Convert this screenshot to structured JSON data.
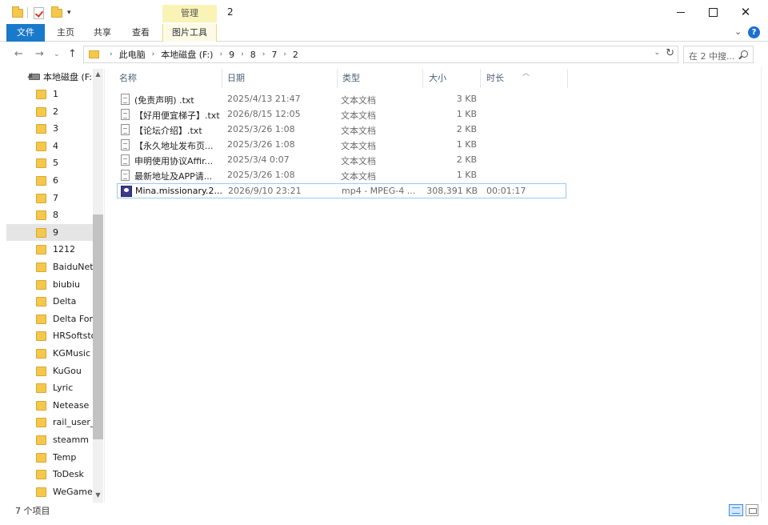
{
  "window": {
    "title": "2",
    "context_tab_header": "管理"
  },
  "ribbon": {
    "tabs": [
      "文件",
      "主页",
      "共享",
      "查看",
      "图片工具"
    ]
  },
  "address": {
    "crumbs": [
      "此电脑",
      "本地磁盘 (F:)",
      "9",
      "8",
      "7",
      "2"
    ]
  },
  "search": {
    "placeholder": "在 2 中搜..."
  },
  "nav": {
    "root_label": "本地磁盘 (F:)",
    "items": [
      "1",
      "2",
      "3",
      "4",
      "5",
      "6",
      "7",
      "8",
      "9",
      "1212",
      "BaiduNetd",
      "biubiu",
      "Delta",
      "Delta Force",
      "HRSoftsto",
      "KGMusic",
      "KuGou",
      "Lyric",
      "Netease",
      "rail_user_d",
      "steamm",
      "Temp",
      "ToDesk",
      "WeGameA"
    ],
    "selected": "9"
  },
  "columns": {
    "name": "名称",
    "date": "日期",
    "type": "类型",
    "size": "大小",
    "duration": "时长"
  },
  "files": [
    {
      "name": "(免责声明) .txt",
      "date": "2025/4/13 21:47",
      "type": "文本文档",
      "size": "3 KB",
      "duration": "",
      "icon": "text-file-icon"
    },
    {
      "name": "【好用便宜梯子】.txt",
      "date": "2026/8/15 12:05",
      "type": "文本文档",
      "size": "1 KB",
      "duration": "",
      "icon": "text-file-icon"
    },
    {
      "name": "【论坛介绍】.txt",
      "date": "2025/3/26 1:08",
      "type": "文本文档",
      "size": "2 KB",
      "duration": "",
      "icon": "text-file-icon"
    },
    {
      "name": "【永久地址发布页...",
      "date": "2025/3/26 1:08",
      "type": "文本文档",
      "size": "1 KB",
      "duration": "",
      "icon": "text-file-icon"
    },
    {
      "name": "申明使用协议Affir...",
      "date": "2025/3/4 0:07",
      "type": "文本文档",
      "size": "2 KB",
      "duration": "",
      "icon": "text-file-icon"
    },
    {
      "name": "最新地址及APP请...",
      "date": "2025/3/26 1:08",
      "type": "文本文档",
      "size": "1 KB",
      "duration": "",
      "icon": "text-file-icon"
    },
    {
      "name": "Mina.missionary.2...",
      "date": "2026/9/10 23:21",
      "type": "mp4 - MPEG-4 ...",
      "size": "308,391 KB",
      "duration": "00:01:17",
      "icon": "video-file-icon"
    }
  ],
  "status": {
    "item_count": "7 个项目"
  }
}
